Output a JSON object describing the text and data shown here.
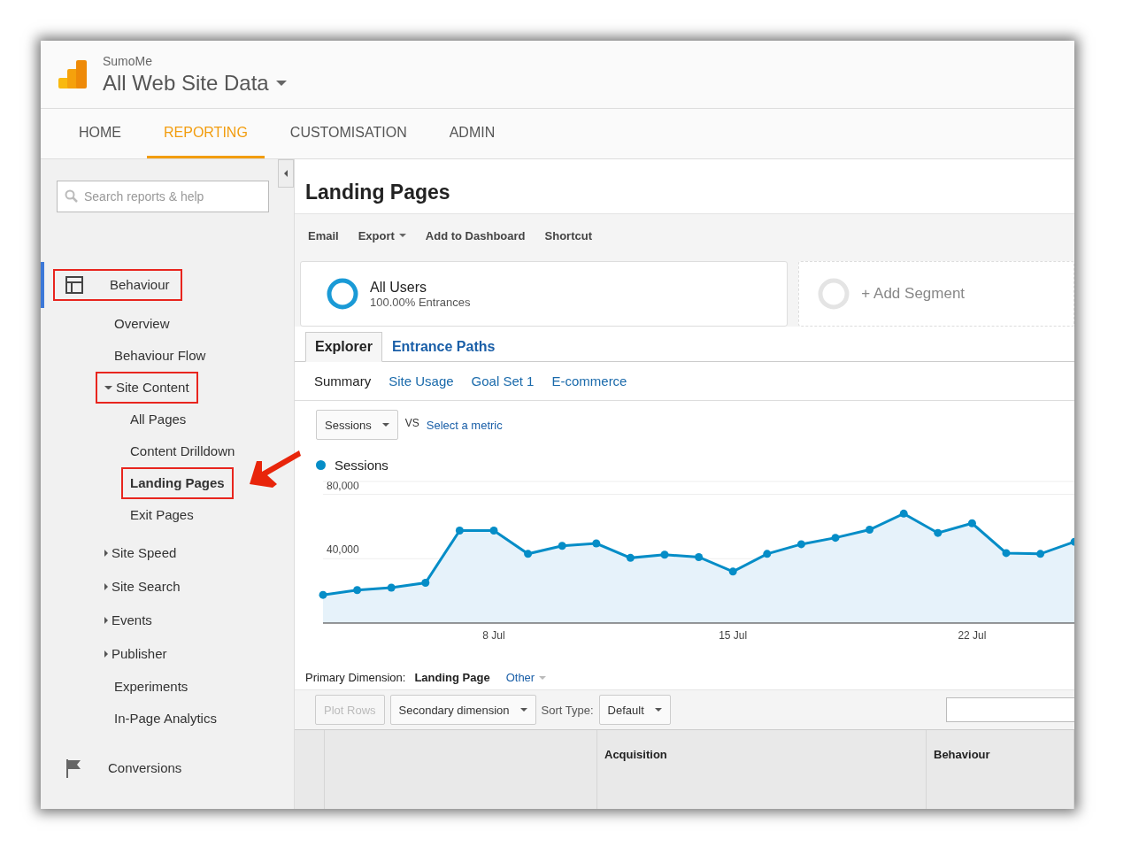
{
  "header": {
    "account": "SumoMe",
    "property": "All Web Site Data"
  },
  "nav": [
    {
      "label": "HOME",
      "selected": false
    },
    {
      "label": "REPORTING",
      "selected": true
    },
    {
      "label": "CUSTOMISATION",
      "selected": false
    },
    {
      "label": "ADMIN",
      "selected": false
    }
  ],
  "sidebar": {
    "search": {
      "placeholder": "Search reports & help"
    },
    "sections": [
      {
        "label": "Behaviour",
        "kind": "layout",
        "active": true,
        "highlighted": true,
        "children": [
          {
            "label": "Overview",
            "selected": false,
            "highlighted": false
          },
          {
            "label": "Behaviour Flow",
            "selected": false,
            "highlighted": false
          },
          {
            "label": "Site Content",
            "expanded": true,
            "selected": false,
            "highlighted": true,
            "children": [
              {
                "label": "All Pages",
                "selected": false,
                "highlighted": false
              },
              {
                "label": "Content Drilldown",
                "selected": false,
                "highlighted": false
              },
              {
                "label": "Landing Pages",
                "selected": true,
                "highlighted": true
              },
              {
                "label": "Exit Pages",
                "selected": false,
                "highlighted": false
              }
            ]
          },
          {
            "label": "Site Speed",
            "expanded": false,
            "selected": false,
            "highlighted": false
          },
          {
            "label": "Site Search",
            "expanded": false,
            "selected": false,
            "highlighted": false
          },
          {
            "label": "Events",
            "expanded": false,
            "selected": false,
            "highlighted": false
          },
          {
            "label": "Publisher",
            "expanded": false,
            "selected": false,
            "highlighted": false
          },
          {
            "label": "Experiments",
            "selected": false,
            "highlighted": false
          },
          {
            "label": "In-Page Analytics",
            "selected": false,
            "highlighted": false
          }
        ]
      },
      {
        "label": "Conversions",
        "kind": "flag",
        "active": false,
        "highlighted": false
      }
    ]
  },
  "page_title": "Landing Pages",
  "toolbar": [
    {
      "label": "Email",
      "dropdown": false
    },
    {
      "label": "Export",
      "dropdown": true
    },
    {
      "label": "Add to Dashboard",
      "dropdown": false
    },
    {
      "label": "Shortcut",
      "dropdown": false
    }
  ],
  "segments": [
    {
      "name": "All Users",
      "detail": "100.00% Entrances",
      "kind": "active"
    },
    {
      "name": "+ Add Segment",
      "kind": "add"
    }
  ],
  "view_tabs": [
    {
      "label": "Explorer",
      "selected": true
    },
    {
      "label": "Entrance Paths",
      "selected": false
    }
  ],
  "sub_tabs": [
    {
      "label": "Summary",
      "selected": true
    },
    {
      "label": "Site Usage",
      "selected": false
    },
    {
      "label": "Goal Set 1",
      "selected": false
    },
    {
      "label": "E-commerce",
      "selected": false
    }
  ],
  "metric": {
    "value": "Sessions",
    "vs": "VS",
    "compare": "Select a metric"
  },
  "chart": {
    "chart_data": {
      "type": "area",
      "series": [
        {
          "name": "Sessions",
          "color": "#058dc7",
          "values": [
            17500,
            20500,
            22000,
            25000,
            57500,
            57500,
            43000,
            48000,
            49500,
            40500,
            42500,
            41000,
            32000,
            43000,
            49000,
            53000,
            58000,
            68000,
            56000,
            62000,
            43500,
            43000,
            50500
          ]
        }
      ],
      "ylim": [
        0,
        88000
      ],
      "yticks": [
        {
          "value": 40000,
          "label": "40,000"
        },
        {
          "value": 80000,
          "label": "80,000"
        }
      ],
      "categories": [
        null,
        null,
        null,
        null,
        null,
        "8 Jul",
        null,
        null,
        null,
        null,
        null,
        null,
        "15 Jul",
        null,
        null,
        null,
        null,
        null,
        null,
        "22 Jul",
        null,
        null,
        null
      ]
    }
  },
  "dimension": {
    "label": "Primary Dimension:",
    "value": "Landing Page",
    "other": "Other"
  },
  "table_controls": {
    "plot_rows": "Plot Rows",
    "secondary": "Secondary dimension",
    "sort_label": "Sort Type:",
    "sort_value": "Default"
  },
  "table": {
    "groups": [
      "Acquisition",
      "Behaviour"
    ]
  }
}
